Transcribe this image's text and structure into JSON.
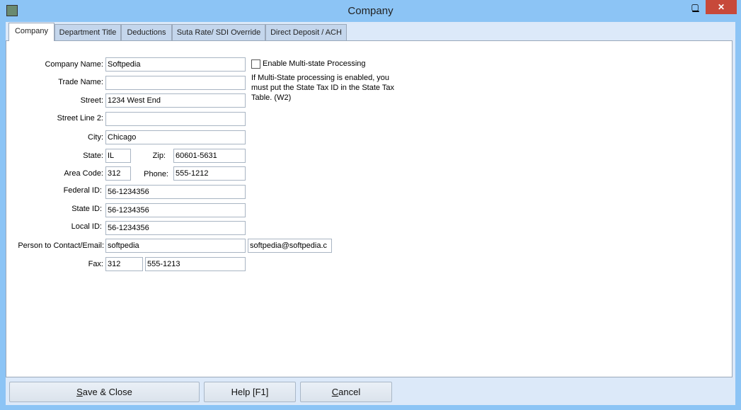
{
  "window": {
    "title": "Company",
    "minimize": "▁",
    "maximize": "▢",
    "close": "✕"
  },
  "tabs": [
    {
      "label": "Company",
      "active": true
    },
    {
      "label": "Department Title"
    },
    {
      "label": "Deductions"
    },
    {
      "label": "Suta Rate/ SDI Override"
    },
    {
      "label": "Direct Deposit / ACH"
    }
  ],
  "form": {
    "company_name": {
      "label": "Company Name:",
      "value": "Softpedia"
    },
    "trade_name": {
      "label": "Trade Name:",
      "value": ""
    },
    "street": {
      "label": "Street:",
      "value": "1234 West End"
    },
    "street2": {
      "label": "Street Line 2:",
      "value": ""
    },
    "city": {
      "label": "City:",
      "value": "Chicago"
    },
    "state": {
      "label": "State:",
      "value": "IL"
    },
    "zip": {
      "label": "Zip:",
      "value": "60601-5631"
    },
    "area_code": {
      "label": "Area Code:",
      "value": "312"
    },
    "phone": {
      "label": "Phone:",
      "value": "555-1212"
    },
    "federal_id": {
      "label": "Federal ID:",
      "value": "56-1234356"
    },
    "state_id": {
      "label": "State ID:",
      "value": "56-1234356"
    },
    "local_id": {
      "label": "Local ID:",
      "value": "56-1234356"
    },
    "contact": {
      "label": "Person to Contact/Email:",
      "value": "softpedia",
      "email": "softpedia@softpedia.c"
    },
    "fax": {
      "label": "Fax:",
      "area": "312",
      "number": "555-1213"
    },
    "multistate": {
      "label": "Enable Multi-state Processing",
      "checked": false,
      "note": "If Multi-State processing is enabled, you must put the State Tax ID in the State Tax Table. (W2)"
    }
  },
  "buttons": {
    "save": {
      "hot": "S",
      "rest": "ave & Close"
    },
    "help": "Help [F1]",
    "cancel": {
      "hot": "C",
      "rest": "ancel"
    }
  }
}
